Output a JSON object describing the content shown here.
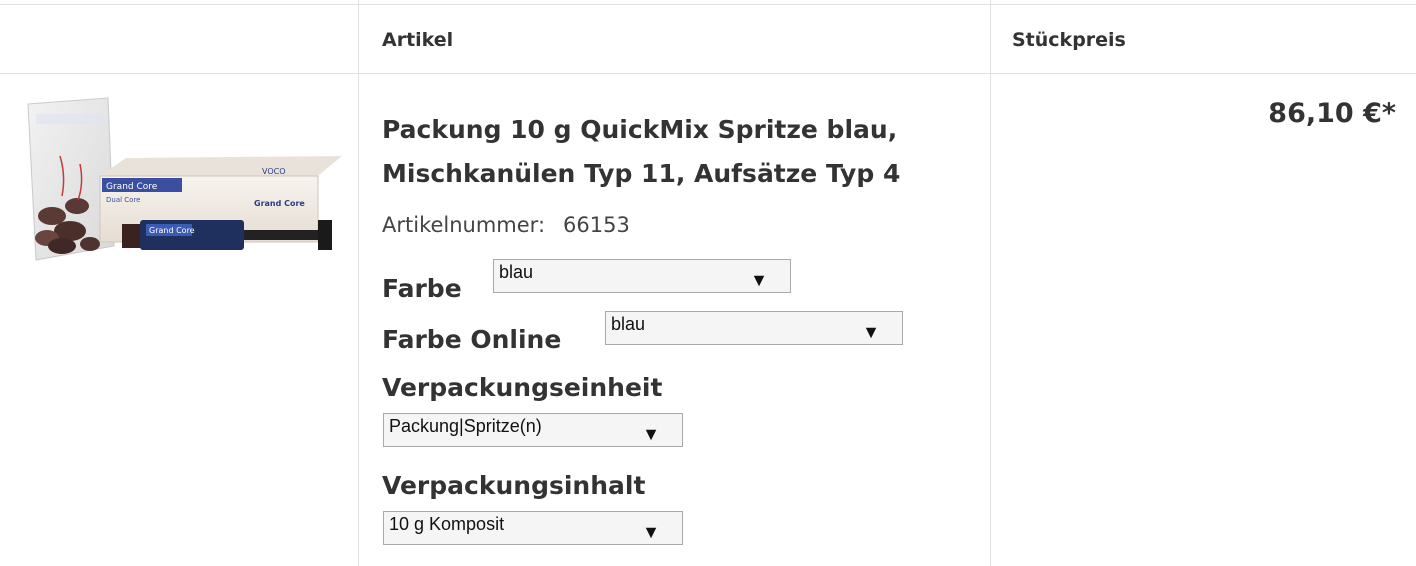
{
  "table": {
    "headers": {
      "article": "Artikel",
      "unit_price": "Stückpreis"
    }
  },
  "product": {
    "title_line1": "Packung 10 g QuickMix Spritze blau,",
    "title_line2": "Mischkanülen Typ 11, Aufsätze Typ 4",
    "article_number_label": "Artikelnummer:",
    "article_number": "66153",
    "price": "86,10 €*",
    "image": {
      "icon": "product-package-icon",
      "box_brand": "Grand Core",
      "box_sub": "Dual Core",
      "box_maker": "VOCO",
      "syringe_brand": "Grand Core"
    },
    "options": {
      "farbe": {
        "label": "Farbe",
        "selected": "blau"
      },
      "farbe_online": {
        "label": "Farbe Online",
        "selected": "blau"
      },
      "verpackungseinheit": {
        "label": "Verpackungseinheit",
        "selected": "Packung|Spritze(n)"
      },
      "verpackungsinhalt": {
        "label": "Verpackungsinhalt",
        "selected": "10 g Komposit"
      }
    }
  },
  "icons": {
    "dropdown_arrow": "▼"
  }
}
